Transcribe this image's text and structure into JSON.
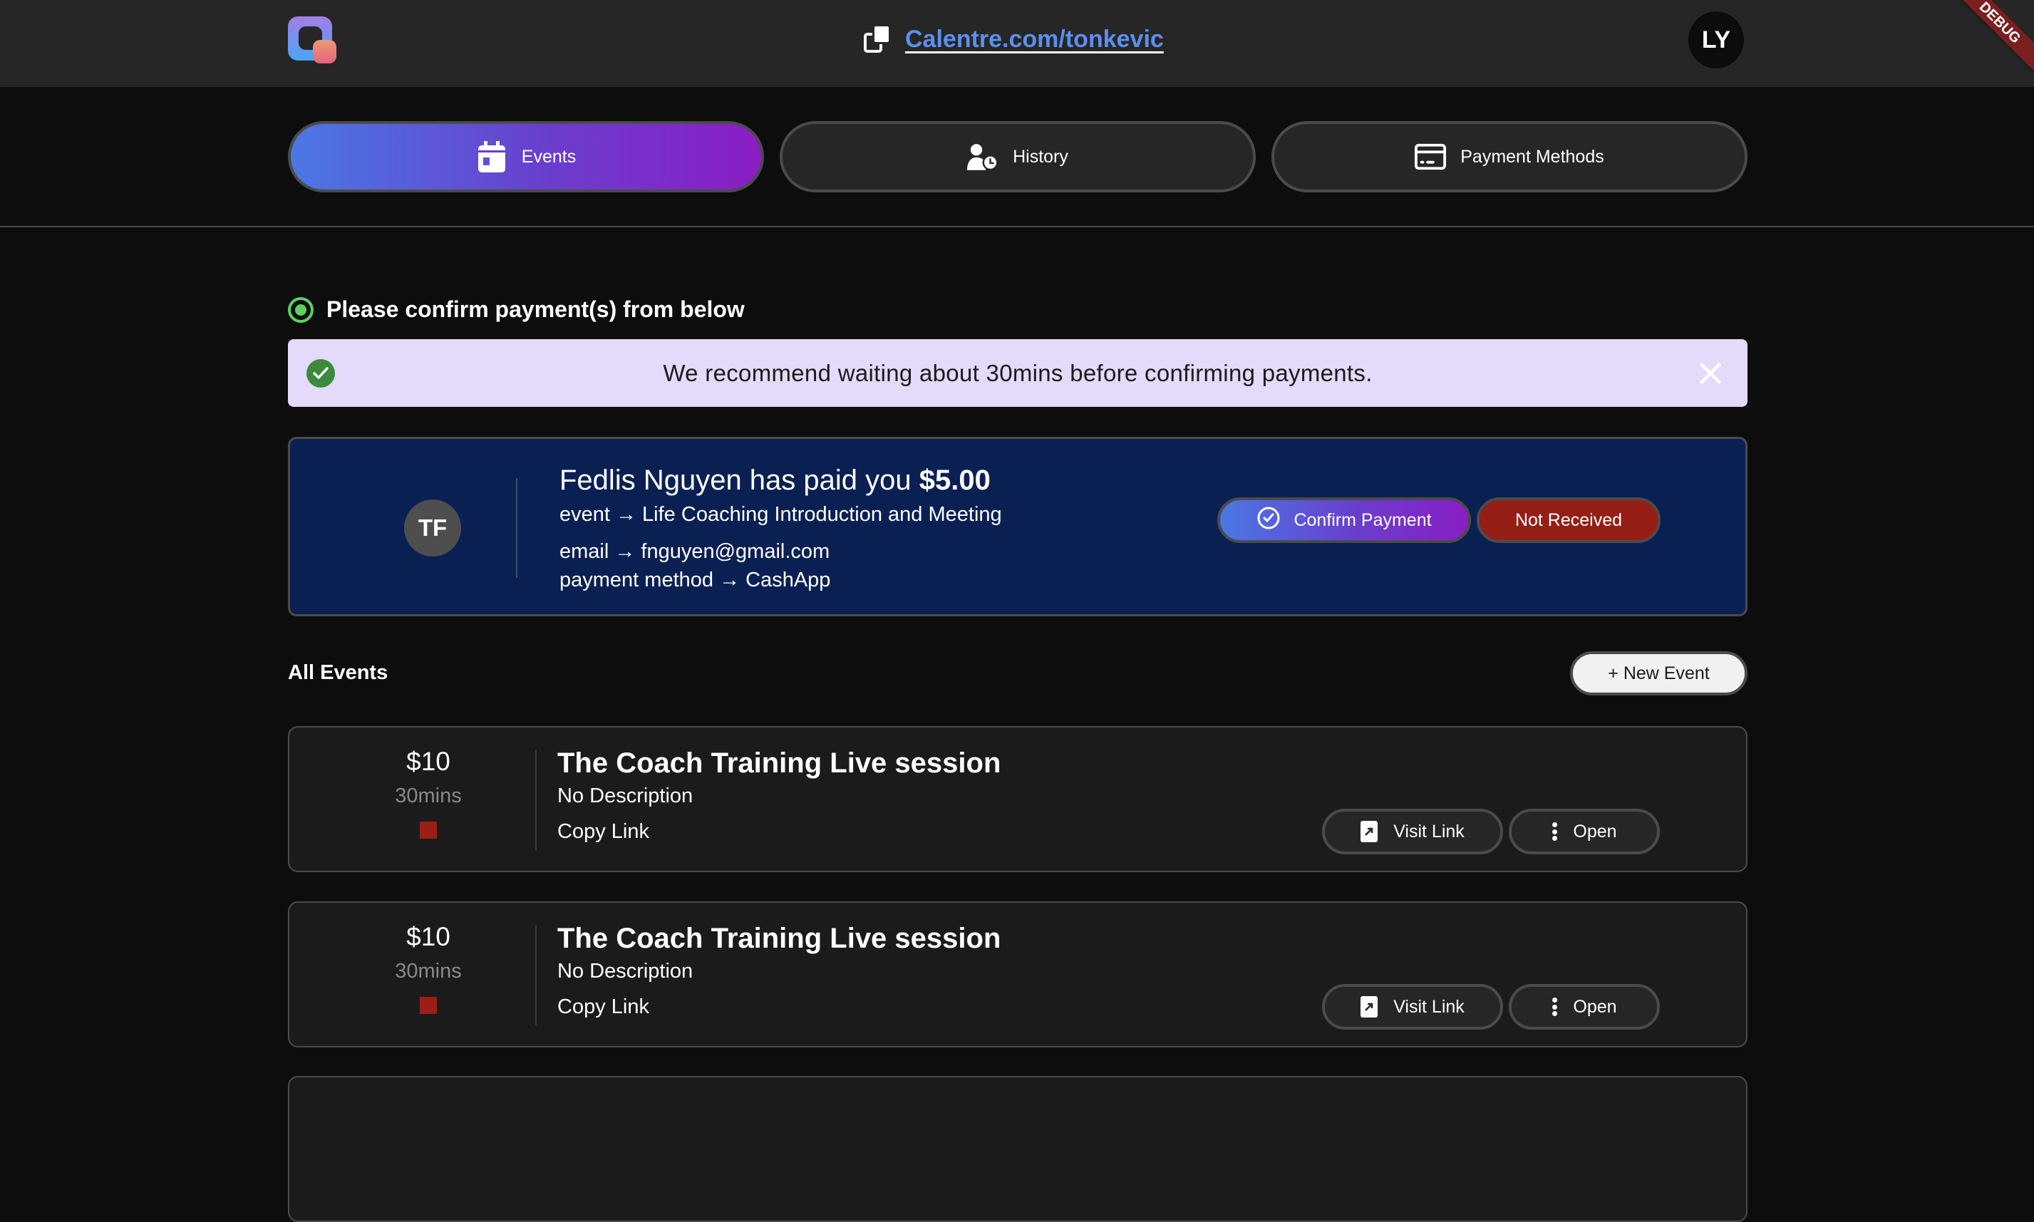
{
  "header": {
    "url_text": "Calentre.com/tonkevic",
    "user_initials": "LY",
    "debug_banner": "DEBUG"
  },
  "tabs": [
    {
      "label": "Events",
      "icon": "calendar-icon",
      "active": true
    },
    {
      "label": "History",
      "icon": "user-clock-icon",
      "active": false
    },
    {
      "label": "Payment Methods",
      "icon": "credit-card-icon",
      "active": false
    }
  ],
  "confirm_section": {
    "heading": "Please confirm payment(s) from below",
    "alert_text": "We recommend waiting about 30mins before confirming payments."
  },
  "payment": {
    "initials": "TF",
    "title_prefix": "Fedlis Nguyen has paid you ",
    "amount": "$5.00",
    "event_line": "event → Life Coaching Introduction and Meeting",
    "email_line": "email → fnguyen@gmail.com",
    "method_line": "payment method → CashApp",
    "confirm_label": "Confirm Payment",
    "not_received_label": "Not Received"
  },
  "events_section": {
    "title": "All Events",
    "new_event_label": "+ New Event"
  },
  "events": [
    {
      "price": "$10",
      "duration": "30mins",
      "color": "#9b1f17",
      "title": "The Coach Training Live session",
      "description": "No Description",
      "copy_link": "Copy Link",
      "visit_label": "Visit Link",
      "open_label": "Open"
    },
    {
      "price": "$10",
      "duration": "30mins",
      "color": "#9b1f17",
      "title": "The Coach Training Live session",
      "description": "No Description",
      "copy_link": "Copy Link",
      "visit_label": "Visit Link",
      "open_label": "Open"
    }
  ],
  "colors": {
    "accent_gradient_start": "#4a78e4",
    "accent_gradient_end": "#8a1dc4",
    "link_blue": "#5b8ff0",
    "danger_red": "#951e16",
    "success_green": "#5ed05e",
    "alert_bg": "#e4daf9",
    "payment_card_bg": "#0b2052"
  }
}
